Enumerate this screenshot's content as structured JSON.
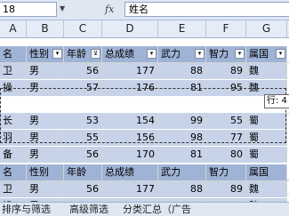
{
  "formula_bar": {
    "name_box": "18",
    "fx": "fx",
    "formula": "姓名"
  },
  "columns": [
    "A",
    "B",
    "C",
    "D",
    "E",
    "F",
    "G",
    "H"
  ],
  "table1": {
    "headers": [
      "名",
      "性别",
      "年龄",
      "总成绩",
      "武力",
      "智力",
      "属国"
    ],
    "rows": [
      [
        "",
        "",
        "",
        "",
        "",
        "",
        "",
        ""
      ],
      [
        "卫",
        "男",
        "56",
        "177",
        "88",
        "89",
        "魏"
      ],
      [
        "操",
        "男",
        "57",
        "176",
        "81",
        "95",
        "魏"
      ],
      [
        "",
        "",
        "",
        "",
        "",
        "",
        ""
      ],
      [
        "长",
        "男",
        "53",
        "154",
        "99",
        "55",
        "蜀"
      ],
      [
        "羽",
        "男",
        "55",
        "156",
        "98",
        "77",
        "蜀"
      ],
      [
        "备",
        "男",
        "56",
        "170",
        "81",
        "80",
        "蜀"
      ]
    ]
  },
  "tooltip": "行: 4",
  "table2": {
    "headers": [
      "名",
      "性别",
      "年龄",
      "总成绩",
      "武力",
      "智力",
      "属国"
    ],
    "rows": [
      [
        "卫",
        "男",
        "56",
        "177",
        "88",
        "89",
        "魏"
      ],
      [
        "操",
        "男",
        "57",
        "176",
        "81",
        "95",
        "魏"
      ]
    ]
  },
  "sheet_tabs": [
    "排序与筛选",
    "高级筛选",
    "分类汇总（广告"
  ]
}
